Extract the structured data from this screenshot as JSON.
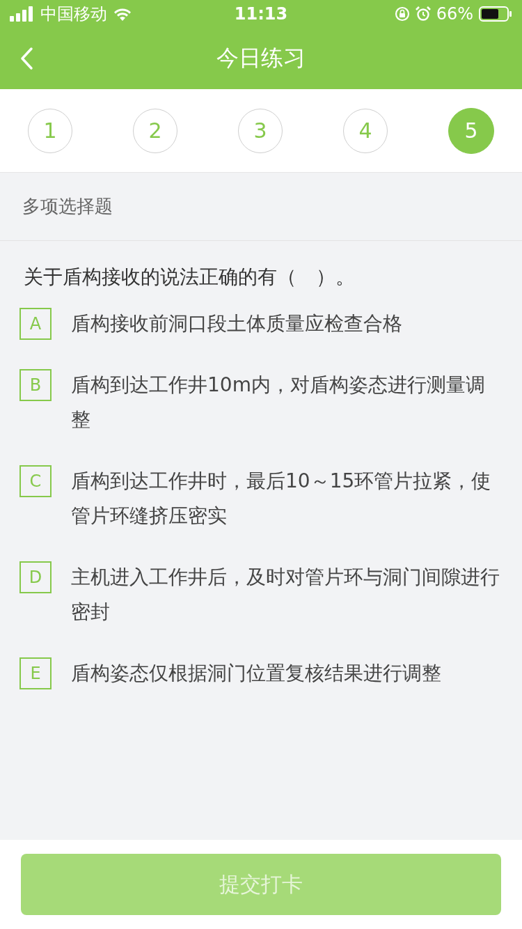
{
  "status_bar": {
    "carrier": "中国移动",
    "time": "11:13",
    "battery": "66%"
  },
  "nav": {
    "title": "今日练习"
  },
  "steps": [
    {
      "label": "1",
      "selected": false
    },
    {
      "label": "2",
      "selected": false
    },
    {
      "label": "3",
      "selected": false
    },
    {
      "label": "4",
      "selected": false
    },
    {
      "label": "5",
      "selected": true
    }
  ],
  "question_type": "多项选择题",
  "question": "关于盾构接收的说法正确的有（　）。",
  "options": [
    {
      "letter": "A",
      "text": "盾构接收前洞口段土体质量应检查合格",
      "selected": false
    },
    {
      "letter": "B",
      "text": "盾构到达工作井10m内，对盾构姿态进行测量调整",
      "selected": false
    },
    {
      "letter": "C",
      "text": "盾构到达工作井时，最后10～15环管片拉紧，使管片环缝挤压密实",
      "selected": false
    },
    {
      "letter": "D",
      "text": "主机进入工作井后，及时对管片环与洞门间隙进行密封",
      "selected": false
    },
    {
      "letter": "E",
      "text": "盾构姿态仅根据洞门位置复核结果进行调整",
      "selected": false
    }
  ],
  "submit": {
    "label": "提交打卡",
    "disabled": true
  }
}
